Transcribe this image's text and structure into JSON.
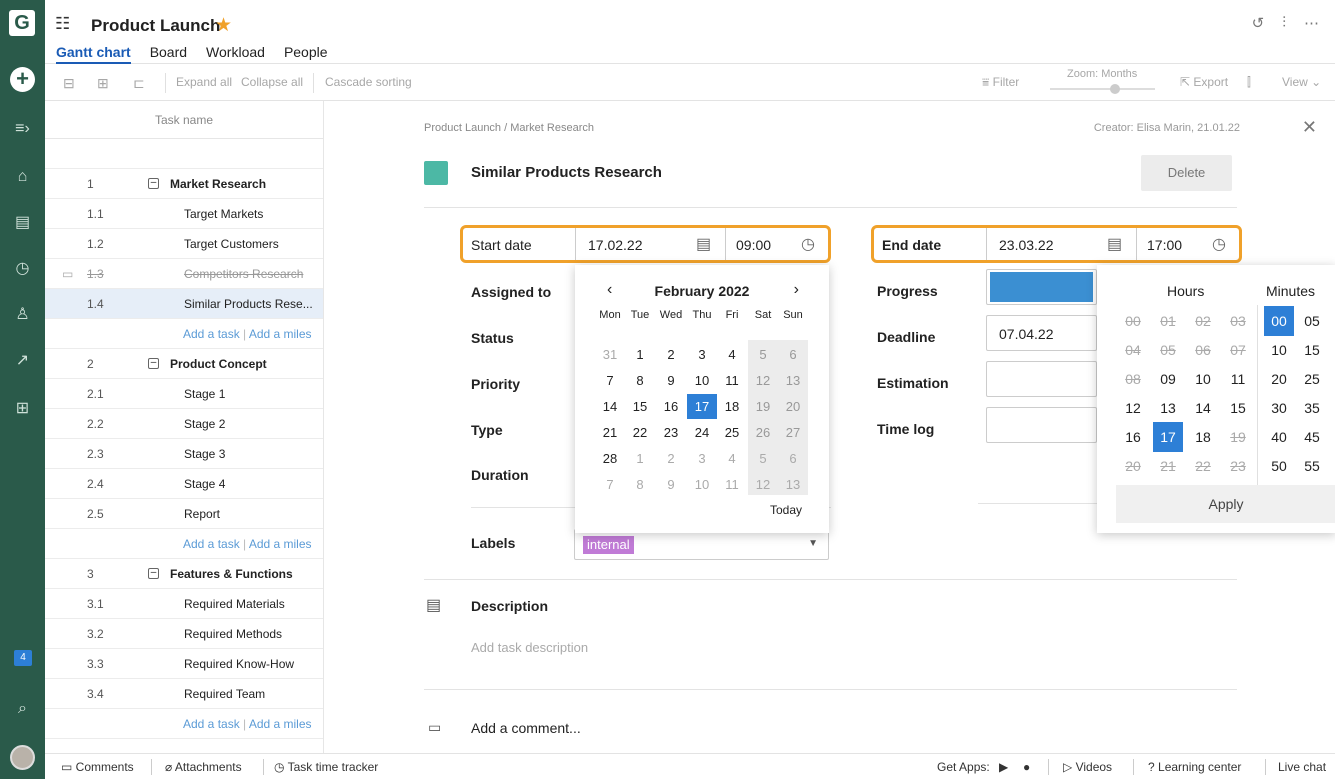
{
  "rail": {
    "logo": "G",
    "badge": "4",
    "icons": [
      "expand-menu-icon",
      "home-icon",
      "tasks-icon",
      "clock-icon",
      "people-icon",
      "trend-icon",
      "apps-icon",
      "notifications-icon",
      "search-icon"
    ]
  },
  "header": {
    "title": "Product Launch",
    "tabs": [
      "Gantt chart",
      "Board",
      "Workload",
      "People"
    ],
    "active_tab": "Gantt chart"
  },
  "toolbar": {
    "expand_all": "Expand all",
    "collapse_all": "Collapse all",
    "cascade_sorting": "Cascade sorting",
    "filter": "Filter",
    "zoom": "Zoom: Months",
    "export": "Export",
    "view": "View"
  },
  "tasklist": {
    "header": "Task name",
    "add_task": "Add a task",
    "add_milestone": "Add a miles",
    "rows": [
      {
        "num": "1",
        "name": "Market Research",
        "type": "group"
      },
      {
        "num": "1.1",
        "name": "Target Markets",
        "type": "task"
      },
      {
        "num": "1.2",
        "name": "Target Customers",
        "type": "task"
      },
      {
        "num": "1.3",
        "name": "Competitors Research",
        "type": "strike"
      },
      {
        "num": "1.4",
        "name": "Similar Products Rese...",
        "type": "selected"
      },
      {
        "num": "",
        "name": "",
        "type": "add"
      },
      {
        "num": "2",
        "name": "Product Concept",
        "type": "group"
      },
      {
        "num": "2.1",
        "name": "Stage 1",
        "type": "task"
      },
      {
        "num": "2.2",
        "name": "Stage 2",
        "type": "task"
      },
      {
        "num": "2.3",
        "name": "Stage 3",
        "type": "task"
      },
      {
        "num": "2.4",
        "name": "Stage 4",
        "type": "task"
      },
      {
        "num": "2.5",
        "name": "Report",
        "type": "task"
      },
      {
        "num": "",
        "name": "",
        "type": "add"
      },
      {
        "num": "3",
        "name": "Features & Functions",
        "type": "group"
      },
      {
        "num": "3.1",
        "name": "Required Materials",
        "type": "task"
      },
      {
        "num": "3.2",
        "name": "Required Methods",
        "type": "task"
      },
      {
        "num": "3.3",
        "name": "Required Know-How",
        "type": "task"
      },
      {
        "num": "3.4",
        "name": "Required Team",
        "type": "task"
      },
      {
        "num": "",
        "name": "",
        "type": "add"
      }
    ]
  },
  "panel": {
    "breadcrumb": "Product Launch / Market Research",
    "creator": "Creator: Elisa Marin, 21.01.22",
    "task_title": "Similar Products Research",
    "delete_label": "Delete",
    "start_date_label": "Start date",
    "start_date": "17.02.22",
    "start_time": "09:00",
    "end_date_label": "End date",
    "end_date": "23.03.22",
    "end_time": "17:00",
    "assigned_to_label": "Assigned to",
    "status_label": "Status",
    "priority_label": "Priority",
    "type_label": "Type",
    "duration_label": "Duration",
    "progress_label": "Progress",
    "deadline_label": "Deadline",
    "deadline": "07.04.22",
    "estimation_label": "Estimation",
    "time_log_label": "Time log",
    "labels_label": "Labels",
    "label_value": "internal",
    "description_label": "Description",
    "description_placeholder": "Add task description",
    "comment_placeholder": "Add a comment..."
  },
  "calendar": {
    "month": "February 2022",
    "weekdays": [
      "Mon",
      "Tue",
      "Wed",
      "Thu",
      "Fri",
      "Sat",
      "Sun"
    ],
    "weeks": [
      [
        "31",
        "1",
        "2",
        "3",
        "4",
        "5",
        "6"
      ],
      [
        "7",
        "8",
        "9",
        "10",
        "11",
        "12",
        "13"
      ],
      [
        "14",
        "15",
        "16",
        "17",
        "18",
        "19",
        "20"
      ],
      [
        "21",
        "22",
        "23",
        "24",
        "25",
        "26",
        "27"
      ],
      [
        "28",
        "1",
        "2",
        "3",
        "4",
        "5",
        "6"
      ],
      [
        "7",
        "8",
        "9",
        "10",
        "11",
        "12",
        "13"
      ]
    ],
    "selected": "17",
    "today_label": "Today"
  },
  "timepicker": {
    "hours_label": "Hours",
    "minutes_label": "Minutes",
    "hours": [
      [
        "00",
        "01",
        "02",
        "03"
      ],
      [
        "04",
        "05",
        "06",
        "07"
      ],
      [
        "08",
        "09",
        "10",
        "11"
      ],
      [
        "12",
        "13",
        "14",
        "15"
      ],
      [
        "16",
        "17",
        "18",
        "19"
      ],
      [
        "20",
        "21",
        "22",
        "23"
      ]
    ],
    "minutes": [
      [
        "00",
        "05"
      ],
      [
        "10",
        "15"
      ],
      [
        "20",
        "25"
      ],
      [
        "30",
        "35"
      ],
      [
        "40",
        "45"
      ],
      [
        "50",
        "55"
      ]
    ],
    "selected_hour": "17",
    "selected_minute": "00",
    "apply_label": "Apply"
  },
  "footer": {
    "comments": "Comments",
    "attachments": "Attachments",
    "time_tracker": "Task time tracker",
    "get_apps": "Get Apps:",
    "videos": "Videos",
    "learning_center": "Learning center",
    "live_chat": "Live chat"
  },
  "colors": {
    "rail": "#2a5a4a",
    "accent": "#2d7fd6",
    "highlight": "#f0a12a",
    "task_color": "#4cb8a5",
    "label_chip": "#c07bd6"
  }
}
